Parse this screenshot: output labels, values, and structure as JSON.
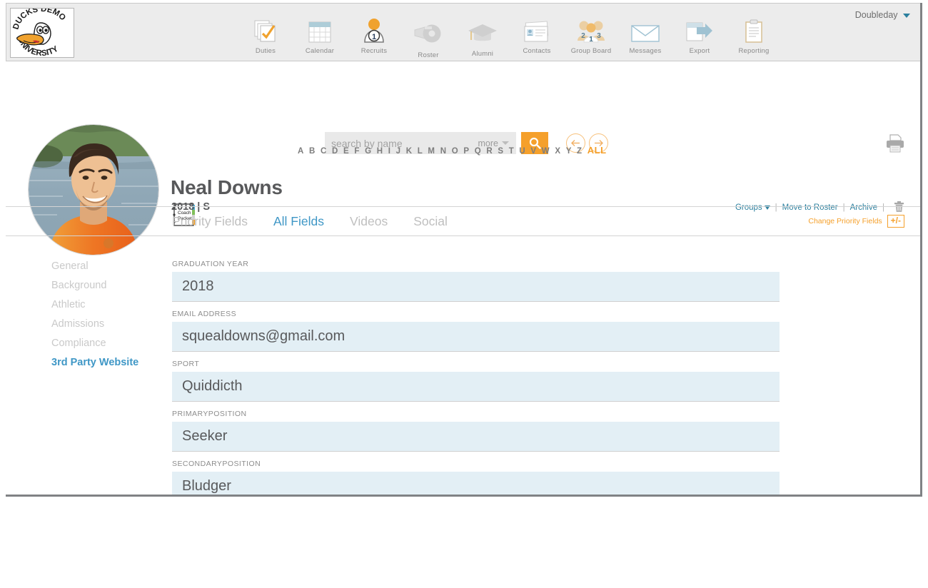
{
  "topbar": {
    "logo": {
      "line_top": "DUCKS DEMO",
      "line_bottom": "UNIVERSITY",
      "alt": "ducks-demo-university-logo"
    },
    "nav": [
      {
        "label": "Duties",
        "icon": "checklist-icon"
      },
      {
        "label": "Calendar",
        "icon": "calendar-icon"
      },
      {
        "label": "Recruits",
        "icon": "recruit-person-icon"
      },
      {
        "label": "Roster",
        "icon": "whistle-icon"
      },
      {
        "label": "Alumni",
        "icon": "graduation-cap-icon"
      },
      {
        "label": "Contacts",
        "icon": "contact-cards-icon"
      },
      {
        "label": "Group Board",
        "icon": "group-people-icon"
      },
      {
        "label": "Messages",
        "icon": "envelope-icon"
      },
      {
        "label": "Export",
        "icon": "export-arrow-icon"
      },
      {
        "label": "Reporting",
        "icon": "clipboard-icon"
      }
    ],
    "account": {
      "name": "Doubleday",
      "icon": "chevron-down-icon"
    }
  },
  "search": {
    "placeholder": "search by name",
    "more_label": "more",
    "search_icon": "magnifier-icon",
    "prev_icon": "arrow-left-icon",
    "next_icon": "arrow-right-icon",
    "print_icon": "printer-icon"
  },
  "alphabet": {
    "letters": [
      "A",
      "B",
      "C",
      "D",
      "E",
      "F",
      "G",
      "H",
      "I",
      "J",
      "K",
      "L",
      "M",
      "N",
      "O",
      "P",
      "Q",
      "R",
      "S",
      "T",
      "U",
      "V",
      "W",
      "X",
      "Y",
      "Z"
    ],
    "all_label": "ALL"
  },
  "profile": {
    "avatar_icon": "user-photo",
    "packet_icon": "coach-packet-icon",
    "packet_line1": "Coach",
    "packet_line2": "Packet",
    "name": "Neal Downs",
    "subtitle": "2018 | S"
  },
  "record_actions": {
    "groups_label": "Groups",
    "move_to_roster_label": "Move to Roster",
    "archive_label": "Archive",
    "trash_icon": "trash-icon",
    "separator": "|"
  },
  "tabs": [
    {
      "label": "Priority Fields",
      "active": false
    },
    {
      "label": "All Fields",
      "active": true
    },
    {
      "label": "Videos",
      "active": false
    },
    {
      "label": "Social",
      "active": false
    }
  ],
  "change_priority": {
    "label": "Change Priority Fields",
    "button_label": "+/-"
  },
  "side_nav": [
    {
      "label": "General",
      "active": false
    },
    {
      "label": "Background",
      "active": false
    },
    {
      "label": "Athletic",
      "active": false
    },
    {
      "label": "Admissions",
      "active": false
    },
    {
      "label": "Compliance",
      "active": false
    },
    {
      "label": "3rd Party Website",
      "active": true
    }
  ],
  "fields": [
    {
      "label": "GRADUATION YEAR",
      "value": "2018"
    },
    {
      "label": "EMAIL ADDRESS",
      "value": "squealdowns@gmail.com"
    },
    {
      "label": "SPORT",
      "value": "Quiddicth"
    },
    {
      "label": "PRIMARYPOSITION",
      "value": "Seeker"
    },
    {
      "label": "SECONDARYPOSITION",
      "value": "Bludger"
    }
  ],
  "colors": {
    "accent_orange": "#f5a02b",
    "accent_blue": "#3f97c6",
    "link_teal": "#2a7f9e",
    "field_bg": "#e3eff5",
    "header_bg": "#ececec",
    "text_gray": "#58595b"
  }
}
